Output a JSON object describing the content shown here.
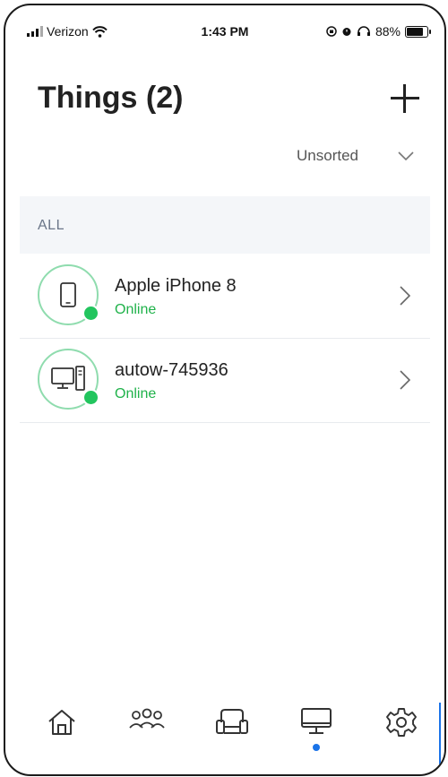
{
  "status_bar": {
    "carrier": "Verizon",
    "time": "1:43 PM",
    "battery": "88%",
    "battery_level": 0.88
  },
  "header": {
    "title": "Things (2)",
    "add_icon": "plus-icon"
  },
  "sort": {
    "label": "Unsorted",
    "icon": "chevron-down-icon"
  },
  "section": {
    "label": "ALL"
  },
  "devices": [
    {
      "name": "Apple iPhone 8",
      "status": "Online",
      "icon": "smartphone-icon"
    },
    {
      "name": "autow-745936",
      "status": "Online",
      "icon": "desktop-computer-icon"
    }
  ],
  "tabs": [
    {
      "icon": "home-icon",
      "active": false
    },
    {
      "icon": "people-icon",
      "active": false
    },
    {
      "icon": "sofa-icon",
      "active": false
    },
    {
      "icon": "monitor-icon",
      "active": true
    },
    {
      "icon": "gear-icon",
      "active": false
    }
  ],
  "colors": {
    "online": "#1fb24a",
    "status_dot": "#22c55e",
    "accent": "#1a73e8",
    "ring": "#8fdcae"
  }
}
